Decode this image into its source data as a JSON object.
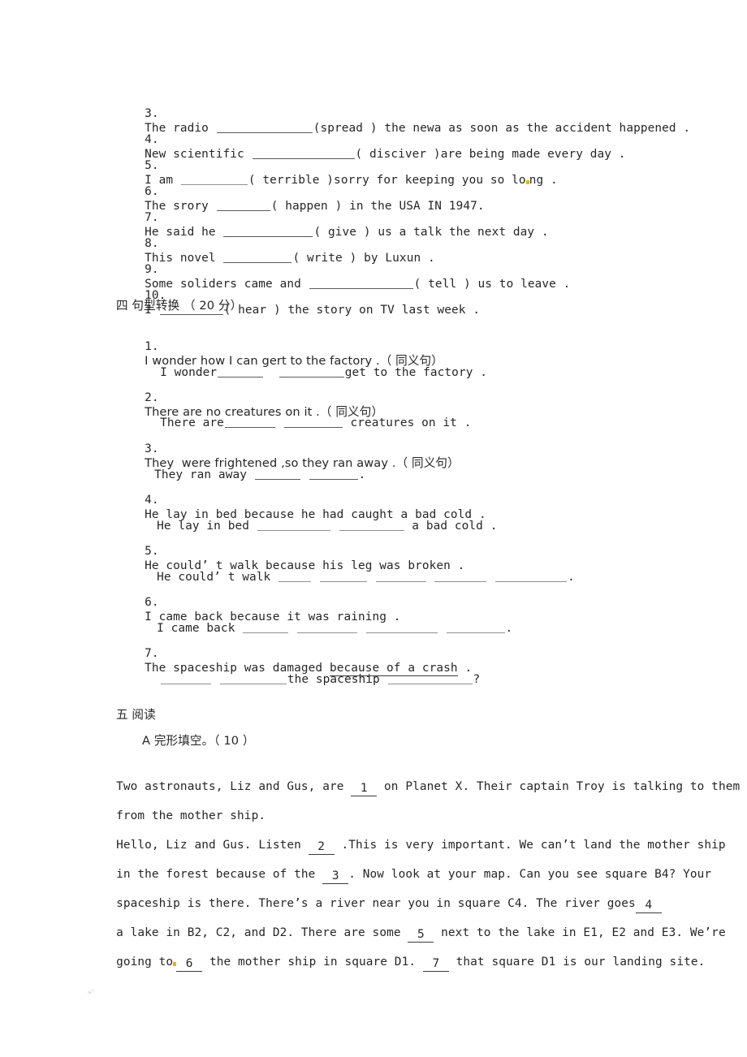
{
  "document": {
    "type": "english-exam-worksheet",
    "page_background": "#ffffff",
    "text_color": "#262626"
  },
  "verb_form_items": [
    {
      "number": "3.",
      "before": "The radio ",
      "blank_width": 118,
      "after": "(spread ) the newa as soon as the accident happened ."
    },
    {
      "number": "4.",
      "before": "New scientific ",
      "blank_width": 126,
      "after": "( disciver )are being made every day ."
    },
    {
      "number": "5.",
      "before": "I am ",
      "blank_width": 82,
      "after": "( terrible )sorry for keeping you so lo",
      "artifact_after": "ng ."
    },
    {
      "number": "6.",
      "before": "The srory ",
      "blank_width": 66,
      "after": "( happen ) in the USA IN 1947."
    },
    {
      "number": "7.",
      "before": "He said he ",
      "blank_width": 110,
      "after": "( give ) us a talk the next day ."
    },
    {
      "number": "8.",
      "before": "This novel ",
      "blank_width": 84,
      "after": "( write ) by Luxun ."
    },
    {
      "number": "9.",
      "before": "Some soliders came and ",
      "blank_width": 128,
      "after": "( tell ) us to leave ."
    },
    {
      "number": "10.",
      "before": "I ",
      "blank_width": 78,
      "after": "( hear ) the story on TV last week ."
    }
  ],
  "section_four": {
    "heading": "四 句型转换 （ 20 分）",
    "items": [
      {
        "number": "1.",
        "prompt": "I wonder how I can gert to the factory .（ 同义句）",
        "answer_before": "I wonder",
        "answer_blank1": 56,
        "answer_mid": "  ",
        "answer_blank2": 80,
        "answer_after": "get to the factory ."
      },
      {
        "number": "2.",
        "prompt": "There are no creatures on it .（ 同义句）",
        "answer_before": "There are",
        "answer_blank1": 62,
        "answer_mid": " ",
        "answer_blank2": 72,
        "answer_after": " creatures on it ."
      },
      {
        "number": "3.",
        "prompt": "They  were frightened ,so they ran away .（ 同义句）",
        "answer_before": "They ran away ",
        "answer_blank1": 56,
        "answer_mid": " ",
        "answer_blank2": 60,
        "answer_after": "."
      },
      {
        "number": "4.",
        "prompt": "He lay in bed because he had caught a bad cold .",
        "answer_before": "He lay in bed ",
        "answer_blank1": 90,
        "answer_mid": " ",
        "answer_blank2": 80,
        "answer_after": " a bad cold ."
      },
      {
        "number": "5.",
        "prompt": "He could’ t walk because his leg was broken .",
        "answer_before": "He could’ t walk ",
        "answer_blanks": [
          40,
          58,
          62,
          64,
          88
        ],
        "answer_after": "."
      },
      {
        "number": "6.",
        "prompt": "I came back because it was raining .",
        "answer_before": "I came back ",
        "answer_blanks": [
          56,
          74,
          88,
          72
        ],
        "answer_after": "."
      },
      {
        "number": "7.",
        "prompt_before": "The spaceship was damaged ",
        "prompt_underlined": "because of a crash",
        "prompt_after": " .",
        "answer_blank1": 62,
        "answer_mid": " ",
        "answer_blank2": 82,
        "answer_text": "the spaceship ",
        "answer_blank3": 104,
        "answer_after": "?"
      }
    ]
  },
  "section_five": {
    "heading": "五 阅读",
    "subheading": "A 完形填空。（ 10 ）",
    "passage_lines": [
      {
        "segments": [
          {
            "text": "Two astronauts, Liz and Gus, are "
          },
          {
            "blank": "1"
          },
          {
            "text": " on Planet X. Their captain Troy is talking to them"
          }
        ]
      },
      {
        "segments": [
          {
            "text": "from the mother ship."
          }
        ]
      },
      {
        "segments": [
          {
            "text": "Hello, Liz and Gus. Listen "
          },
          {
            "blank": "2"
          },
          {
            "text": " .This is very important. We can’t land the mother ship"
          }
        ]
      },
      {
        "segments": [
          {
            "text": "in the forest because of the "
          },
          {
            "blank": "3"
          },
          {
            "text": ". Now look at your map. Can you see square B4? Your"
          }
        ]
      },
      {
        "segments": [
          {
            "text": "spaceship is there. There’s a river near you in square C4. The river goes"
          },
          {
            "blank": "4"
          }
        ]
      },
      {
        "segments": [
          {
            "text": "a lake in B2, C2, and D2. There are some "
          },
          {
            "blank": "5"
          },
          {
            "text": " next to the lake in E1, E2 and E3. We’re"
          }
        ]
      },
      {
        "segments": [
          {
            "text": "going to"
          },
          {
            "artifact": true
          },
          {
            "blank": "6"
          },
          {
            "text": " the mother ship in square D1. "
          },
          {
            "blank": "7"
          },
          {
            "text": " that square D1 is our landing site."
          }
        ]
      }
    ]
  }
}
